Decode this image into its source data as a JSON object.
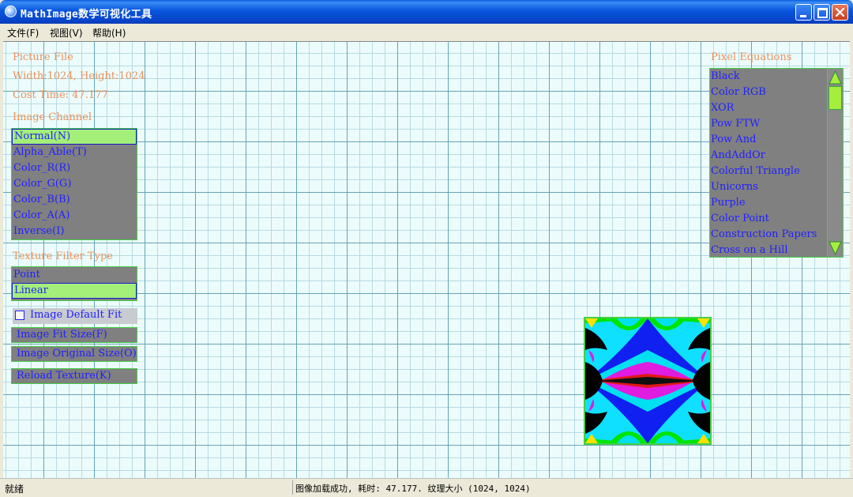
{
  "window": {
    "title": "MathImage数学可视化工具",
    "icon": "globe-icon",
    "controls": [
      "minimize-icon",
      "maximize-icon",
      "close-icon"
    ]
  },
  "menu": [
    "文件(F)",
    "视图(V)",
    "帮助(H)"
  ],
  "info": {
    "picture_file_label": "Picture File",
    "size_text": "Width:1024, Height:1024",
    "cost_time_text": "Cost Time: 47.177"
  },
  "image_channel": {
    "label": "Image Channel",
    "items": [
      "Normal(N)",
      "Alpha_Able(T)",
      "Color_R(R)",
      "Color_G(G)",
      "Color_B(B)",
      "Color_A(A)",
      "Inverse(I)"
    ],
    "selected": "Normal(N)"
  },
  "texture_filter": {
    "label": "Texture Filter Type",
    "items": [
      "Point",
      "Linear"
    ],
    "selected": "Linear"
  },
  "options": {
    "default_fit_label": "Image Default Fit",
    "default_fit_checked": false,
    "fit_size_label": "Image Fit Size(F)",
    "original_size_label": "Image Original Size(O)",
    "reload_label": "Reload Texture(K)"
  },
  "pixel_equations": {
    "label": "Pixel Equations",
    "items": [
      "Black",
      "Color RGB",
      "XOR",
      "Pow FTW",
      "Pow And",
      "AndAddOr",
      "Colorful Triangle",
      "Unicorns",
      "Purple",
      "Color Point",
      "Construction Papers",
      "Cross on a Hill"
    ]
  },
  "status": {
    "left": "就绪",
    "right": "图像加载成功, 耗时: 47.177. 纹理大小 (1024, 1024)"
  },
  "colors": {
    "title_bar": "#0855dd",
    "label_orange": "#e8905a",
    "item_blue": "#2020ff",
    "list_gray": "#808080",
    "selection_green": "#a4ee7a",
    "border_green": "#44d044",
    "grid_bg": "#ecfcfc"
  }
}
